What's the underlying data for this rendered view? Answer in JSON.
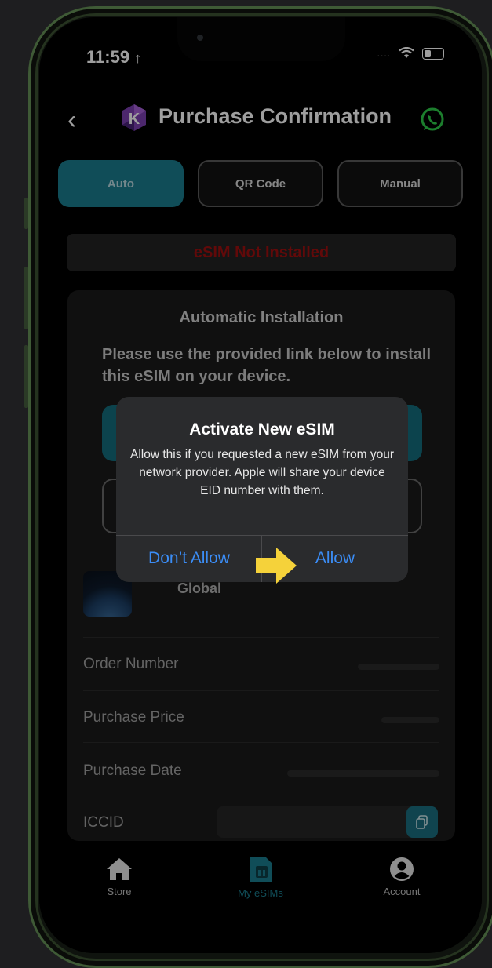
{
  "status_bar": {
    "time": "11:59",
    "signal": "....",
    "wifi_icon": "wifi-icon",
    "battery_icon": "battery-icon"
  },
  "header": {
    "title": "Purchase Confirmation",
    "back_icon": "chevron-left-icon",
    "logo_letter": "K",
    "whatsapp_icon": "whatsapp-icon"
  },
  "tabs": [
    {
      "label": "Auto",
      "active": true
    },
    {
      "label": "QR Code",
      "active": false
    },
    {
      "label": "Manual",
      "active": false
    }
  ],
  "banner": {
    "text": "eSIM Not Installed",
    "color": "#9e0f10"
  },
  "install_card": {
    "title": "Automatic Installation",
    "description": "Please use the provided link below to install this eSIM on your device."
  },
  "plan": {
    "name": "Global"
  },
  "details": [
    {
      "label": "Order Number"
    },
    {
      "label": "Purchase Price"
    },
    {
      "label": "Purchase Date"
    },
    {
      "label": "ICCID"
    }
  ],
  "alert": {
    "title": "Activate New eSIM",
    "message": "Allow this if you requested a new eSIM from your network provider. Apple will share your device EID number with them.",
    "deny_label": "Don’t Allow",
    "allow_label": "Allow"
  },
  "tabbar": [
    {
      "label": "Store",
      "icon": "home-icon",
      "active": false
    },
    {
      "label": "My eSIMs",
      "icon": "sim-card-icon",
      "active": true
    },
    {
      "label": "Account",
      "icon": "account-icon",
      "active": false
    }
  ],
  "colors": {
    "accent": "#1b7d8e",
    "alert_button": "#3b8df6",
    "arrow": "#f5d23a"
  }
}
